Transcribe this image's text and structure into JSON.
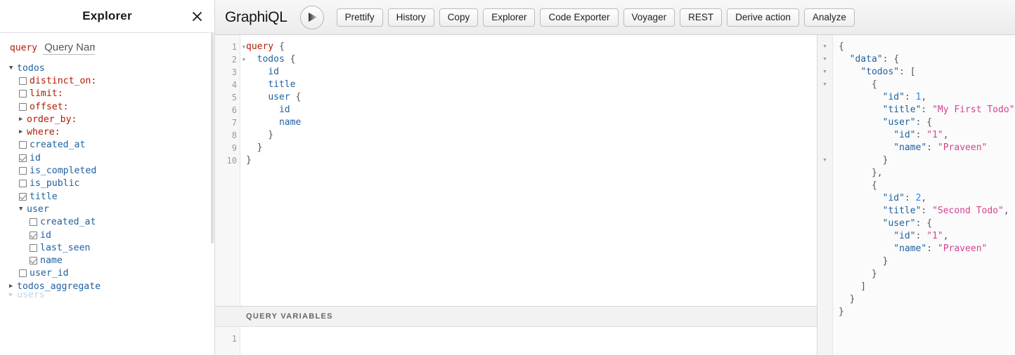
{
  "explorer": {
    "title": "Explorer",
    "close_icon": "close-icon",
    "query_keyword": "query",
    "query_name_placeholder": "Query Name",
    "query_name_value": "",
    "tree": [
      {
        "indent": 0,
        "control": "arrow-down",
        "label": "todos",
        "color": "blue"
      },
      {
        "indent": 1,
        "control": "checkbox",
        "checked": false,
        "label": "distinct_on:",
        "color": "purple"
      },
      {
        "indent": 1,
        "control": "checkbox",
        "checked": false,
        "label": "limit:",
        "color": "purple"
      },
      {
        "indent": 1,
        "control": "checkbox",
        "checked": false,
        "label": "offset:",
        "color": "purple"
      },
      {
        "indent": 1,
        "control": "arrow-right",
        "label": "order_by:",
        "color": "purple"
      },
      {
        "indent": 1,
        "control": "arrow-right",
        "label": "where:",
        "color": "purple"
      },
      {
        "indent": 1,
        "control": "checkbox",
        "checked": false,
        "label": "created_at",
        "color": "blue"
      },
      {
        "indent": 1,
        "control": "checkbox",
        "checked": true,
        "label": "id",
        "color": "blue"
      },
      {
        "indent": 1,
        "control": "checkbox",
        "checked": false,
        "label": "is_completed",
        "color": "blue"
      },
      {
        "indent": 1,
        "control": "checkbox",
        "checked": false,
        "label": "is_public",
        "color": "blue"
      },
      {
        "indent": 1,
        "control": "checkbox",
        "checked": true,
        "label": "title",
        "color": "blue"
      },
      {
        "indent": 1,
        "control": "arrow-down",
        "label": "user",
        "color": "blue"
      },
      {
        "indent": 2,
        "control": "checkbox",
        "checked": false,
        "label": "created_at",
        "color": "blue"
      },
      {
        "indent": 2,
        "control": "checkbox",
        "checked": true,
        "label": "id",
        "color": "blue"
      },
      {
        "indent": 2,
        "control": "checkbox",
        "checked": false,
        "label": "last_seen",
        "color": "blue"
      },
      {
        "indent": 2,
        "control": "checkbox",
        "checked": true,
        "label": "name",
        "color": "blue"
      },
      {
        "indent": 1,
        "control": "checkbox",
        "checked": false,
        "label": "user_id",
        "color": "blue"
      },
      {
        "indent": 0,
        "control": "arrow-right",
        "label": "todos_aggregate",
        "color": "blue"
      },
      {
        "indent": 0,
        "control": "arrow-right",
        "label": "users",
        "color": "blue",
        "clipped": true
      }
    ]
  },
  "toolbar": {
    "logo": "GraphiQL",
    "execute_icon": "play-icon",
    "buttons": [
      "Prettify",
      "History",
      "Copy",
      "Explorer",
      "Code Exporter",
      "Voyager",
      "REST",
      "Derive action",
      "Analyze"
    ]
  },
  "editor": {
    "line_numbers": [
      "1",
      "2",
      "3",
      "4",
      "5",
      "6",
      "7",
      "8",
      "9",
      "10"
    ],
    "fold_lines": [
      1,
      2
    ],
    "lines": [
      [
        {
          "t": "query",
          "c": "kw"
        },
        {
          "t": " {",
          "c": "pun"
        }
      ],
      [
        {
          "t": "  ",
          "c": "pun"
        },
        {
          "t": "todos",
          "c": "fld"
        },
        {
          "t": " {",
          "c": "pun"
        }
      ],
      [
        {
          "t": "    ",
          "c": "pun"
        },
        {
          "t": "id",
          "c": "fld"
        }
      ],
      [
        {
          "t": "    ",
          "c": "pun"
        },
        {
          "t": "title",
          "c": "fld"
        }
      ],
      [
        {
          "t": "    ",
          "c": "pun"
        },
        {
          "t": "user",
          "c": "fld"
        },
        {
          "t": " {",
          "c": "pun"
        }
      ],
      [
        {
          "t": "      ",
          "c": "pun"
        },
        {
          "t": "id",
          "c": "fld"
        }
      ],
      [
        {
          "t": "      ",
          "c": "pun"
        },
        {
          "t": "name",
          "c": "fld"
        }
      ],
      [
        {
          "t": "    }",
          "c": "pun"
        }
      ],
      [
        {
          "t": "  }",
          "c": "pun"
        }
      ],
      [
        {
          "t": "}",
          "c": "pun"
        }
      ]
    ]
  },
  "query_variables": {
    "header": "QUERY VARIABLES",
    "line_numbers": [
      "1"
    ],
    "value": ""
  },
  "results": {
    "fold_rows": [
      1,
      2,
      3,
      4,
      10
    ],
    "lines": [
      [
        {
          "t": "{",
          "c": "brc"
        }
      ],
      [
        {
          "t": "  ",
          "c": "brc"
        },
        {
          "t": "\"data\"",
          "c": "key"
        },
        {
          "t": ": {",
          "c": "brc"
        }
      ],
      [
        {
          "t": "    ",
          "c": "brc"
        },
        {
          "t": "\"todos\"",
          "c": "key"
        },
        {
          "t": ": [",
          "c": "brc"
        }
      ],
      [
        {
          "t": "      {",
          "c": "brc"
        }
      ],
      [
        {
          "t": "        ",
          "c": "brc"
        },
        {
          "t": "\"id\"",
          "c": "key"
        },
        {
          "t": ": ",
          "c": "brc"
        },
        {
          "t": "1",
          "c": "num"
        },
        {
          "t": ",",
          "c": "brc"
        }
      ],
      [
        {
          "t": "        ",
          "c": "brc"
        },
        {
          "t": "\"title\"",
          "c": "key"
        },
        {
          "t": ": ",
          "c": "brc"
        },
        {
          "t": "\"My First Todo\"",
          "c": "str"
        },
        {
          "t": ",",
          "c": "brc"
        }
      ],
      [
        {
          "t": "        ",
          "c": "brc"
        },
        {
          "t": "\"user\"",
          "c": "key"
        },
        {
          "t": ": {",
          "c": "brc"
        }
      ],
      [
        {
          "t": "          ",
          "c": "brc"
        },
        {
          "t": "\"id\"",
          "c": "key"
        },
        {
          "t": ": ",
          "c": "brc"
        },
        {
          "t": "\"1\"",
          "c": "str"
        },
        {
          "t": ",",
          "c": "brc"
        }
      ],
      [
        {
          "t": "          ",
          "c": "brc"
        },
        {
          "t": "\"name\"",
          "c": "key"
        },
        {
          "t": ": ",
          "c": "brc"
        },
        {
          "t": "\"Praveen\"",
          "c": "str"
        }
      ],
      [
        {
          "t": "        }",
          "c": "brc"
        }
      ],
      [
        {
          "t": "      },",
          "c": "brc"
        }
      ],
      [
        {
          "t": "      {",
          "c": "brc"
        }
      ],
      [
        {
          "t": "        ",
          "c": "brc"
        },
        {
          "t": "\"id\"",
          "c": "key"
        },
        {
          "t": ": ",
          "c": "brc"
        },
        {
          "t": "2",
          "c": "num"
        },
        {
          "t": ",",
          "c": "brc"
        }
      ],
      [
        {
          "t": "        ",
          "c": "brc"
        },
        {
          "t": "\"title\"",
          "c": "key"
        },
        {
          "t": ": ",
          "c": "brc"
        },
        {
          "t": "\"Second Todo\"",
          "c": "str"
        },
        {
          "t": ",",
          "c": "brc"
        }
      ],
      [
        {
          "t": "        ",
          "c": "brc"
        },
        {
          "t": "\"user\"",
          "c": "key"
        },
        {
          "t": ": {",
          "c": "brc"
        }
      ],
      [
        {
          "t": "          ",
          "c": "brc"
        },
        {
          "t": "\"id\"",
          "c": "key"
        },
        {
          "t": ": ",
          "c": "brc"
        },
        {
          "t": "\"1\"",
          "c": "str"
        },
        {
          "t": ",",
          "c": "brc"
        }
      ],
      [
        {
          "t": "          ",
          "c": "brc"
        },
        {
          "t": "\"name\"",
          "c": "key"
        },
        {
          "t": ": ",
          "c": "brc"
        },
        {
          "t": "\"Praveen\"",
          "c": "str"
        }
      ],
      [
        {
          "t": "        }",
          "c": "brc"
        }
      ],
      [
        {
          "t": "      }",
          "c": "brc"
        }
      ],
      [
        {
          "t": "    ]",
          "c": "brc"
        }
      ],
      [
        {
          "t": "  }",
          "c": "brc"
        }
      ],
      [
        {
          "t": "}",
          "c": "brc"
        }
      ]
    ]
  },
  "colors": {
    "keyword": "#b11a04",
    "field": "#1f61a0",
    "json_key": "#1f61a0",
    "json_string": "#d64292",
    "json_number": "#2882f9",
    "toolbar_bg": "#ececec",
    "border": "#d6d6d6"
  }
}
